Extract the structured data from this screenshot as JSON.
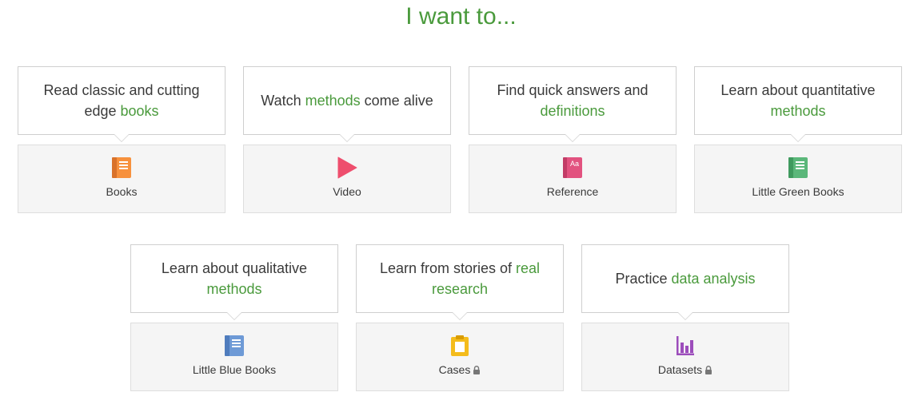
{
  "heading": "I want to...",
  "colors": {
    "accent_green": "#4a9a3c",
    "books_orange": "#f7913d",
    "video_red": "#ee4e6d",
    "reference_pink": "#e2527f",
    "green_books": "#5bb77a",
    "blue_books": "#6e9ad6",
    "cases_yellow": "#f4bc1c",
    "datasets_purple": "#9c4dbb"
  },
  "cards": [
    {
      "prompt_before": "Read classic and cutting edge ",
      "prompt_highlight": "books",
      "prompt_after": "",
      "label": "Books",
      "icon": "book-icon",
      "locked": false
    },
    {
      "prompt_before": "Watch ",
      "prompt_highlight": "methods",
      "prompt_after": " come alive",
      "label": "Video",
      "icon": "play-icon",
      "locked": false
    },
    {
      "prompt_before": "Find quick answers and ",
      "prompt_highlight": "definitions",
      "prompt_after": "",
      "label": "Reference",
      "icon": "dictionary-icon",
      "locked": false
    },
    {
      "prompt_before": "Learn about quantitative ",
      "prompt_highlight": "methods",
      "prompt_after": "",
      "label": "Little Green Books",
      "icon": "green-book-icon",
      "locked": false
    },
    {
      "prompt_before": "Learn about qualitative ",
      "prompt_highlight": "methods",
      "prompt_after": "",
      "label": "Little Blue Books",
      "icon": "blue-book-icon",
      "locked": false
    },
    {
      "prompt_before": "Learn from stories of ",
      "prompt_highlight": "real research",
      "prompt_after": "",
      "label": "Cases",
      "icon": "clipboard-icon",
      "locked": true
    },
    {
      "prompt_before": "Practice ",
      "prompt_highlight": "data analysis",
      "prompt_after": "",
      "label": "Datasets",
      "icon": "bar-chart-icon",
      "locked": true
    }
  ]
}
